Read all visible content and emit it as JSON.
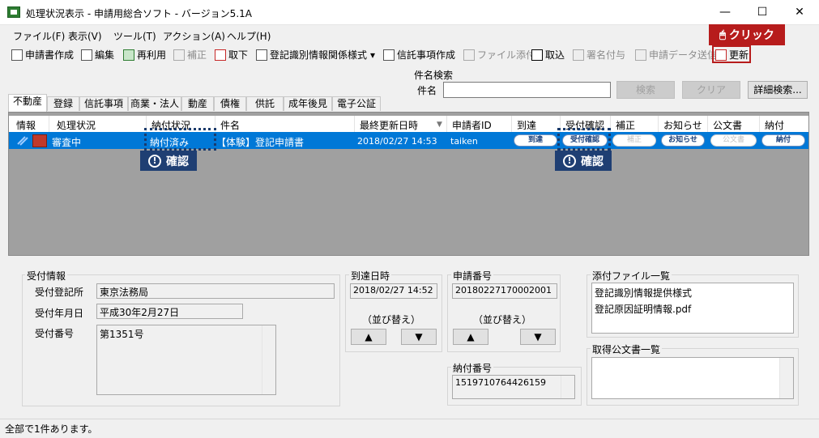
{
  "window": {
    "title": "処理状況表示 - 申請用総合ソフト - バージョン5.1A",
    "minimize": "—",
    "maximize": "☐",
    "close": "✕"
  },
  "menu": [
    "ファイル(F)",
    "表示(V)",
    "ツール(T)",
    "アクション(A)",
    "ヘルプ(H)"
  ],
  "toolbar": {
    "create": "申請書作成",
    "edit": "編集",
    "reuse": "再利用",
    "correct": "補正",
    "withdraw": "取下",
    "reg_form": "登記識別情報関係様式",
    "reg_form_arrow": "▾",
    "trust": "信託事項作成",
    "attach": "ファイル添付",
    "import": "取込",
    "sign": "署名付与",
    "send": "申請データ送信",
    "refresh": "更新"
  },
  "search": {
    "group": "件名検索",
    "label": "件名",
    "value": "",
    "search_btn": "検索",
    "clear_btn": "クリア",
    "detail_btn": "詳細検索..."
  },
  "tabs": [
    "不動産",
    "登録",
    "信託事項",
    "商業・法人",
    "動産",
    "債権",
    "供託",
    "成年後見",
    "電子公証"
  ],
  "grid": {
    "headers": [
      "情報",
      "処理状況",
      "納付状況",
      "件名",
      "最終更新日時",
      "申請者ID",
      "到達",
      "受付確認",
      "補正",
      "お知らせ",
      "公文書",
      "納付"
    ],
    "sort_indicator": "▼",
    "row": {
      "status": "審査中",
      "payment": "納付済み",
      "subject": "【体験】登記申請書",
      "updated": "2018/02/27 14:53",
      "applicant": "taiken",
      "arrival": "到達",
      "receipt": "受付確認",
      "correction": "補正",
      "notice": "お知らせ",
      "official": "公文書",
      "pay": "納付"
    }
  },
  "callouts": {
    "confirm1": "確認",
    "confirm2": "確認",
    "info_symbol": "!",
    "click": "クリック"
  },
  "receipt_info": {
    "group": "受付情報",
    "office_label": "受付登記所",
    "office_value": "東京法務局",
    "date_label": "受付年月日",
    "date_value": "平成30年2月27日",
    "number_label": "受付番号",
    "number_value": "第1351号"
  },
  "arrival": {
    "group": "到達日時",
    "value": "2018/02/27 14:52",
    "sort_label": "（並び替え）",
    "up": "▲",
    "down": "▼"
  },
  "application": {
    "group": "申請番号",
    "value": "20180227170002001",
    "sort_label": "（並び替え）",
    "up": "▲",
    "down": "▼"
  },
  "payment_no": {
    "group": "納付番号",
    "value": "1519710764426159"
  },
  "attachments": {
    "group": "添付ファイル一覧",
    "items": [
      "登記識別情報提供様式",
      "登記原因証明情報.pdf"
    ]
  },
  "documents": {
    "group": "取得公文書一覧"
  },
  "statusbar": "全部で1件あります。",
  "colors": {
    "selection": "#0078d7",
    "callout_blue": "#1f3f73",
    "callout_red": "#b71c1c"
  }
}
